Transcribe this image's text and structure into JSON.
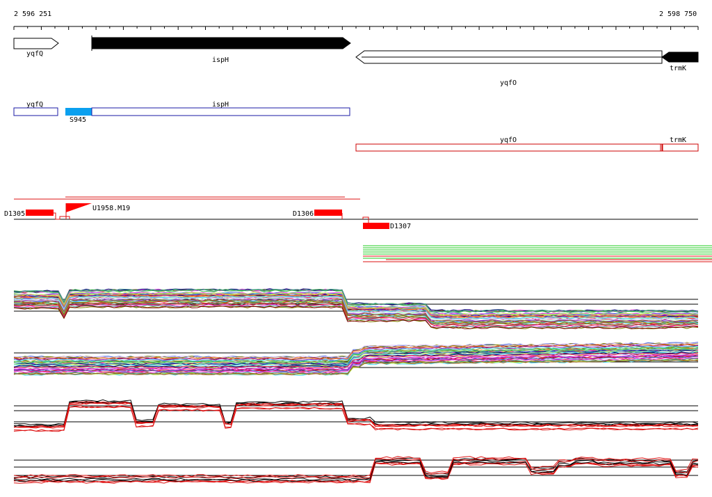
{
  "ruler": {
    "start_label": "2 596 251",
    "end_label": "2 598 750"
  },
  "genes": {
    "yqfQ": "yqfQ",
    "ispH": "ispH",
    "yqfO": "yqfO",
    "trmK": "trmK"
  },
  "annotations": {
    "transcript_yqfQ": "yqfQ",
    "transcript_ispH": "ispH",
    "site_S945": "S945",
    "transcript_yqfO": "yqfO",
    "transcript_trmK": "trmK"
  },
  "probes": {
    "D1305": "D1305",
    "D1306": "D1306",
    "D1307": "D1307",
    "U1958": "U1958.M19"
  },
  "colors": {
    "upper_strand_track": "#1a1aa6",
    "site_fill": "#0aa0ef",
    "lower_strand_track": "#cc0000",
    "probe_fill": "#ff0000",
    "green_lines": "#22cc22",
    "red_lines": "#dd1111"
  }
}
